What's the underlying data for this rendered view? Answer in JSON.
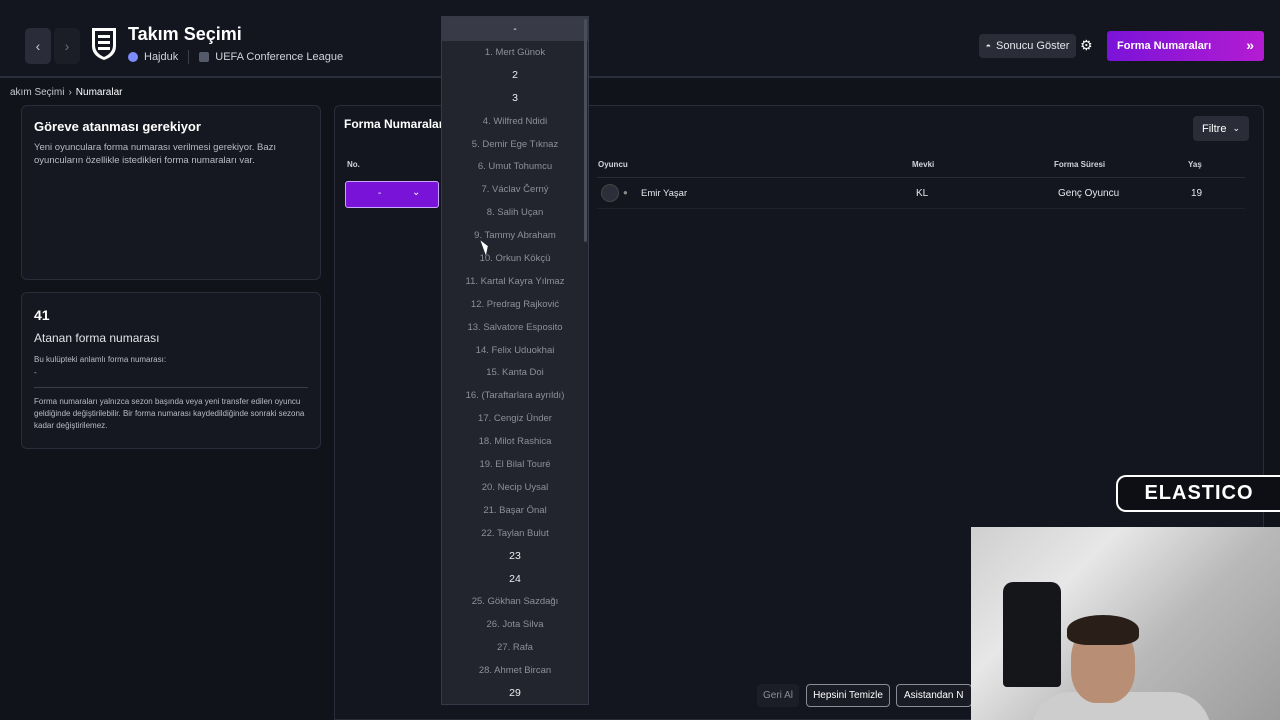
{
  "header": {
    "title": "Takım Seçimi",
    "club": "Hajduk",
    "competition": "UEFA Conference League",
    "result_btn": "Sonucu Göster",
    "primary_btn": "Forma Numaraları"
  },
  "breadcrumb": {
    "parent": "akım Seçimi",
    "current": "Numaralar"
  },
  "card1": {
    "title": "Göreve atanması gerekiyor",
    "text": "Yeni oyunculara forma numarası verilmesi gerekiyor. Bazı oyuncuların özellikle istedikleri forma numaraları var."
  },
  "card2": {
    "number": "41",
    "label": "Atanan forma numarası",
    "meaningful": "Bu kulüpteki anlamlı forma numarası:",
    "meaningful_value": "-",
    "note": "Forma numaraları yalnızca sezon başında veya yeni transfer edilen oyuncu geldiğinde değiştirilebilir. Bir forma numarası kaydedildiğinde sonraki sezona kadar değiştirilemez."
  },
  "main": {
    "title": "Forma Numaraları",
    "filter": "Filtre",
    "columns": {
      "no": "No.",
      "player": "Oyuncu",
      "position": "Mevki",
      "duration": "Forma Süresi",
      "age": "Yaş"
    },
    "row": {
      "no": "-",
      "player": "Emir Yaşar",
      "position": "KL",
      "duration": "Genç Oyuncu",
      "age": "19"
    }
  },
  "dropdown": {
    "selected": "-",
    "items": [
      {
        "label": "1. Mert Günok",
        "free": false
      },
      {
        "label": "2",
        "free": true
      },
      {
        "label": "3",
        "free": true
      },
      {
        "label": "4. Wilfred Ndidi",
        "free": false
      },
      {
        "label": "5. Demir Ege Tıknaz",
        "free": false
      },
      {
        "label": "6. Umut Tohumcu",
        "free": false
      },
      {
        "label": "7. Václav Černý",
        "free": false
      },
      {
        "label": "8. Salih Uçan",
        "free": false
      },
      {
        "label": "9. Tammy Abraham",
        "free": false
      },
      {
        "label": "10. Orkun Kökçü",
        "free": false
      },
      {
        "label": "11. Kartal Kayra Yılmaz",
        "free": false
      },
      {
        "label": "12. Predrag Rajković",
        "free": false
      },
      {
        "label": "13. Salvatore Esposito",
        "free": false
      },
      {
        "label": "14. Felix Uduokhai",
        "free": false
      },
      {
        "label": "15. Kanta Doi",
        "free": false
      },
      {
        "label": "16. (Taraftarlara ayrıldı)",
        "free": false
      },
      {
        "label": "17. Cengiz Ünder",
        "free": false
      },
      {
        "label": "18. Milot Rashica",
        "free": false
      },
      {
        "label": "19. El Bilal Touré",
        "free": false
      },
      {
        "label": "20. Necip Uysal",
        "free": false
      },
      {
        "label": "21. Başar Önal",
        "free": false
      },
      {
        "label": "22. Taylan Bulut",
        "free": false
      },
      {
        "label": "23",
        "free": true
      },
      {
        "label": "24",
        "free": true
      },
      {
        "label": "25. Gökhan Sazdağı",
        "free": false
      },
      {
        "label": "26. Jota Silva",
        "free": false
      },
      {
        "label": "27. Rafa",
        "free": false
      },
      {
        "label": "28. Ahmet Bircan",
        "free": false
      },
      {
        "label": "29",
        "free": true
      }
    ]
  },
  "footer": {
    "undo": "Geri Al",
    "clear_all": "Hepsini Temizle",
    "assistant": "Asistandan N"
  },
  "overlay": {
    "brand": "ELASTICO"
  }
}
